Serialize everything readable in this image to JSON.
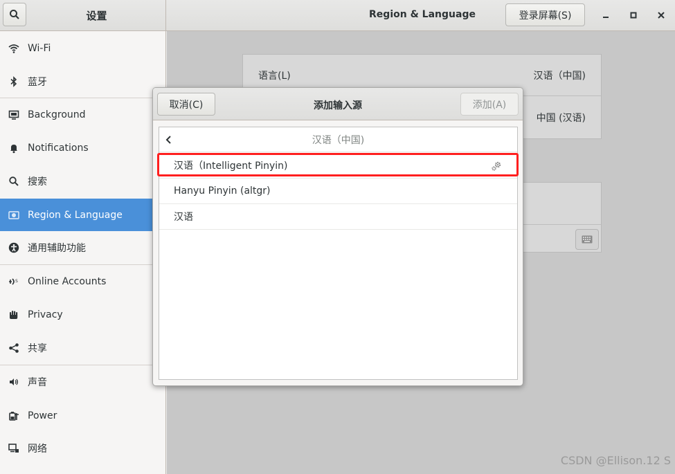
{
  "header": {
    "left_title": "设置",
    "main_title": "Region & Language",
    "login_screen_button": "登录屏幕(S)",
    "window_controls": [
      "minimize-icon",
      "maximize-icon",
      "close-icon"
    ]
  },
  "sidebar": {
    "items": [
      {
        "label": "Wi-Fi",
        "icon": "wifi-icon"
      },
      {
        "label": "蓝牙",
        "icon": "bluetooth-icon"
      },
      {
        "label": "Background",
        "icon": "background-icon"
      },
      {
        "label": "Notifications",
        "icon": "bell-icon"
      },
      {
        "label": "搜索",
        "icon": "search-icon"
      },
      {
        "label": "Region & Language",
        "icon": "region-icon",
        "active": true
      },
      {
        "label": "通用辅助功能",
        "icon": "accessibility-icon"
      },
      {
        "label": "Online Accounts",
        "icon": "online-accounts-icon"
      },
      {
        "label": "Privacy",
        "icon": "privacy-hand-icon"
      },
      {
        "label": "共享",
        "icon": "share-icon"
      },
      {
        "label": "声音",
        "icon": "speaker-icon"
      },
      {
        "label": "Power",
        "icon": "power-icon"
      },
      {
        "label": "网络",
        "icon": "network-icon"
      }
    ]
  },
  "main": {
    "language_label": "语言(L)",
    "language_value": "汉语（中国)",
    "formats_value": "中国 (汉语)"
  },
  "dialog": {
    "cancel_label": "取消(C)",
    "title": "添加输入源",
    "add_label": "添加(A)",
    "list_header": "汉语（中国)",
    "items": [
      {
        "label": "汉语（Intelligent Pinyin)",
        "has_settings": true
      },
      {
        "label": "Hanyu Pinyin (altgr)"
      },
      {
        "label": "汉语"
      }
    ]
  },
  "colors": {
    "accent": "#4a90d9",
    "highlight_box": "#ff1f1f"
  },
  "watermark": "CSDN @Ellison.12 S"
}
